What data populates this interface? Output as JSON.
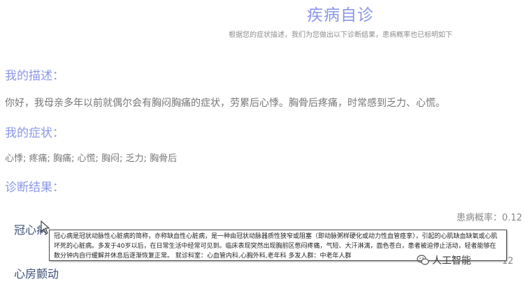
{
  "header": {
    "title": "疾病自诊",
    "subtitle": "根据您的症状描述，我们为您做出以下诊断结果，患病概率也已标明如下"
  },
  "description": {
    "heading": "我的描述：",
    "text": "你好，我母亲多年以前就偶尔会有胸闷胸痛的症状，劳累后心悸。胸骨后疼痛，时常感到乏力、心慌。"
  },
  "symptoms": {
    "heading": "我的症状：",
    "text": "心悸; 疼痛; 胸痛; 心慌; 胸闷; 乏力; 胸骨后"
  },
  "results": {
    "heading": "诊断结果：",
    "items": [
      {
        "name": "冠心病",
        "probability_label": "患病概率：0.12"
      },
      {
        "name": "心房颤动",
        "probability_label": "12"
      }
    ],
    "tooltip": "冠心病是冠状动脉性心脏病的简称，亦称缺血性心脏病，是一种由冠状动脉器质性狭窄或阻塞（即动脉粥样硬化或动力性血管痉挛），引起的心肌缺血缺氧或心肌坏死的心脏病。多发于40岁以后，在日常生活中经常可见到。临床表现突然出现胸前区憋闷疼痛，气短、大汗淋漓，面色苍白，患者被迫停止活动，轻者能够在数分钟内自行缓解并休息后逐渐恢复正常。 就诊科室：心血管内科,心胸外科,老年科 多发人群：中老年人群"
  },
  "watermark": {
    "icon": "wechat-icon",
    "text": "人工智能"
  },
  "colors": {
    "accent": "#8a97e6",
    "result_name": "#3c4f7a"
  }
}
